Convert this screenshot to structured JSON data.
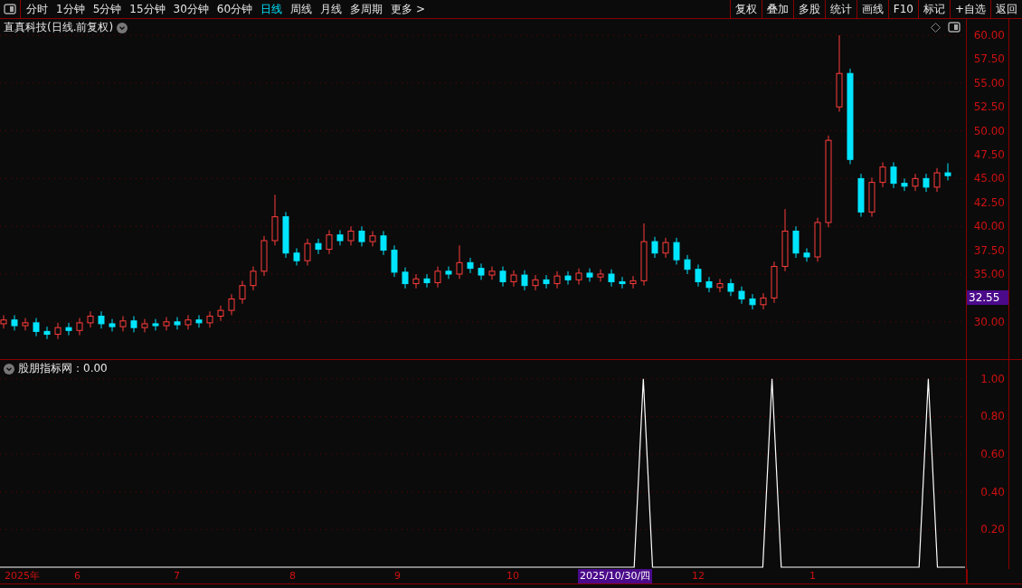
{
  "toolbar": {
    "periods": [
      {
        "label": "分时",
        "selected": false
      },
      {
        "label": "1分钟",
        "selected": false
      },
      {
        "label": "5分钟",
        "selected": false
      },
      {
        "label": "15分钟",
        "selected": false
      },
      {
        "label": "30分钟",
        "selected": false
      },
      {
        "label": "60分钟",
        "selected": false
      },
      {
        "label": "日线",
        "selected": true
      },
      {
        "label": "周线",
        "selected": false
      },
      {
        "label": "月线",
        "selected": false
      },
      {
        "label": "多周期",
        "selected": false
      },
      {
        "label": "更多 >",
        "selected": false
      }
    ],
    "buttons": [
      "复权",
      "叠加",
      "多股",
      "统计",
      "画线",
      "F10",
      "标记",
      "+自选",
      "返回"
    ]
  },
  "chart": {
    "title": "直真科技(日线.前复权)",
    "last_price": "32.55",
    "chart_data": {
      "type": "candlestick",
      "ylim": [
        26.1,
        61.7
      ],
      "grid": true,
      "yticks": [
        {
          "value": 60,
          "label": "60.00"
        },
        {
          "value": 57.5,
          "label": "57.50"
        },
        {
          "value": 55,
          "label": "55.00"
        },
        {
          "value": 52.5,
          "label": "52.50"
        },
        {
          "value": 50,
          "label": "50.00"
        },
        {
          "value": 47.5,
          "label": "47.50"
        },
        {
          "value": 45,
          "label": "45.00"
        },
        {
          "value": 42.5,
          "label": "42.50"
        },
        {
          "value": 40,
          "label": "40.00"
        },
        {
          "value": 37.5,
          "label": "37.50"
        },
        {
          "value": 35,
          "label": "35.00"
        },
        {
          "value": 30,
          "label": "30.00"
        }
      ],
      "ohlc": [
        [
          29.8,
          30.7,
          29.3,
          30.2
        ],
        [
          30.2,
          30.7,
          29.1,
          29.6
        ],
        [
          29.6,
          30.4,
          29.1,
          29.9
        ],
        [
          29.9,
          30.4,
          28.5,
          29.0
        ],
        [
          29.0,
          29.5,
          28.2,
          28.7
        ],
        [
          28.7,
          29.9,
          28.2,
          29.4
        ],
        [
          29.4,
          29.9,
          28.6,
          29.1
        ],
        [
          29.1,
          30.4,
          28.6,
          29.9
        ],
        [
          29.9,
          31.1,
          29.4,
          30.6
        ],
        [
          30.6,
          31.1,
          29.3,
          29.8
        ],
        [
          29.8,
          30.3,
          29.0,
          29.5
        ],
        [
          29.5,
          30.6,
          29.0,
          30.1
        ],
        [
          30.1,
          30.6,
          28.9,
          29.4
        ],
        [
          29.4,
          30.3,
          28.9,
          29.8
        ],
        [
          29.8,
          30.3,
          29.1,
          29.6
        ],
        [
          29.6,
          30.5,
          29.1,
          30.0
        ],
        [
          30.0,
          30.5,
          29.2,
          29.7
        ],
        [
          29.7,
          30.7,
          29.2,
          30.2
        ],
        [
          30.2,
          30.7,
          29.4,
          29.9
        ],
        [
          29.9,
          31.1,
          29.4,
          30.6
        ],
        [
          30.6,
          31.7,
          30.1,
          31.2
        ],
        [
          31.2,
          32.9,
          30.7,
          32.4
        ],
        [
          32.4,
          34.3,
          31.9,
          33.8
        ],
        [
          33.8,
          35.8,
          33.3,
          35.3
        ],
        [
          35.3,
          39.0,
          34.8,
          38.5
        ],
        [
          38.5,
          43.3,
          38.0,
          41.0
        ],
        [
          41.0,
          41.5,
          36.7,
          37.2
        ],
        [
          37.2,
          37.7,
          35.9,
          36.4
        ],
        [
          36.4,
          38.7,
          35.9,
          38.2
        ],
        [
          38.2,
          38.7,
          37.1,
          37.6
        ],
        [
          37.6,
          39.6,
          37.1,
          39.1
        ],
        [
          39.1,
          39.6,
          38.0,
          38.5
        ],
        [
          38.5,
          40.0,
          38.0,
          39.5
        ],
        [
          39.5,
          40.0,
          37.9,
          38.4
        ],
        [
          38.4,
          39.5,
          37.9,
          39.0
        ],
        [
          39.0,
          39.5,
          37.0,
          37.5
        ],
        [
          37.5,
          38.0,
          34.7,
          35.2
        ],
        [
          35.2,
          35.7,
          33.5,
          34.0
        ],
        [
          34.0,
          35.0,
          33.5,
          34.5
        ],
        [
          34.5,
          35.0,
          33.6,
          34.1
        ],
        [
          34.1,
          35.8,
          33.6,
          35.3
        ],
        [
          35.3,
          35.8,
          34.5,
          35.0
        ],
        [
          35.0,
          38.0,
          34.5,
          36.2
        ],
        [
          36.2,
          36.7,
          35.1,
          35.6
        ],
        [
          35.6,
          36.1,
          34.4,
          34.9
        ],
        [
          34.9,
          35.8,
          34.4,
          35.3
        ],
        [
          35.3,
          35.8,
          33.7,
          34.2
        ],
        [
          34.2,
          35.4,
          33.7,
          34.9
        ],
        [
          34.9,
          35.4,
          33.3,
          33.8
        ],
        [
          33.8,
          34.9,
          33.3,
          34.4
        ],
        [
          34.4,
          34.9,
          33.5,
          34.0
        ],
        [
          34.0,
          35.3,
          33.5,
          34.8
        ],
        [
          34.8,
          35.3,
          33.9,
          34.4
        ],
        [
          34.4,
          35.6,
          33.9,
          35.1
        ],
        [
          35.1,
          35.6,
          34.2,
          34.7
        ],
        [
          34.7,
          35.5,
          34.2,
          35.0
        ],
        [
          35.0,
          35.5,
          33.7,
          34.2
        ],
        [
          34.2,
          34.7,
          33.5,
          34.0
        ],
        [
          34.0,
          34.8,
          33.5,
          34.3
        ],
        [
          34.3,
          40.3,
          33.8,
          38.4
        ],
        [
          38.4,
          38.9,
          36.7,
          37.2
        ],
        [
          37.2,
          38.8,
          36.7,
          38.3
        ],
        [
          38.3,
          38.8,
          36.0,
          36.5
        ],
        [
          36.5,
          37.0,
          35.0,
          35.5
        ],
        [
          35.5,
          36.0,
          33.7,
          34.2
        ],
        [
          34.2,
          34.7,
          33.1,
          33.6
        ],
        [
          33.6,
          34.5,
          33.1,
          34.0
        ],
        [
          34.0,
          34.5,
          32.7,
          33.2
        ],
        [
          33.2,
          33.7,
          31.9,
          32.4
        ],
        [
          32.4,
          32.9,
          31.3,
          31.8
        ],
        [
          31.8,
          33.0,
          31.3,
          32.5
        ],
        [
          32.5,
          36.3,
          32.0,
          35.8
        ],
        [
          35.8,
          41.8,
          35.3,
          39.5
        ],
        [
          39.5,
          40.0,
          36.7,
          37.2
        ],
        [
          37.2,
          37.7,
          36.3,
          36.8
        ],
        [
          36.8,
          40.9,
          36.3,
          40.4
        ],
        [
          40.4,
          49.5,
          39.9,
          49.0
        ],
        [
          52.5,
          60.0,
          52.0,
          56.0
        ],
        [
          56.0,
          56.5,
          46.5,
          47.0
        ],
        [
          45.0,
          45.5,
          41.0,
          41.5
        ],
        [
          41.5,
          45.1,
          41.0,
          44.6
        ],
        [
          44.6,
          46.7,
          44.1,
          46.2
        ],
        [
          46.2,
          46.7,
          44.0,
          44.5
        ],
        [
          44.5,
          45.0,
          43.7,
          44.2
        ],
        [
          44.2,
          45.5,
          43.7,
          45.0
        ],
        [
          45.0,
          45.5,
          43.6,
          44.1
        ],
        [
          44.1,
          46.1,
          43.6,
          45.6
        ],
        [
          45.6,
          46.6,
          44.8,
          45.3
        ]
      ]
    }
  },
  "indicator": {
    "value": "：0.00",
    "chart_data": {
      "type": "line",
      "yticks": [
        {
          "value": 1.0,
          "label": "1.00"
        },
        {
          "value": 0.8,
          "label": "0.80"
        },
        {
          "value": 0.6,
          "label": "0.60"
        },
        {
          "value": 0.4,
          "label": "0.40"
        },
        {
          "value": 0.2,
          "label": "0.20"
        }
      ],
      "series": [
        {
          "name": "股朋指标网",
          "color": "#ffffff",
          "values": [
            0,
            0,
            0,
            0,
            0,
            0,
            0,
            0,
            0,
            0,
            0,
            0,
            0,
            0,
            0,
            0,
            0,
            0,
            0,
            0,
            0,
            0,
            0,
            0,
            0,
            0,
            0,
            0,
            0,
            0,
            0,
            0,
            0,
            0,
            0,
            0,
            0,
            0,
            0,
            0,
            0,
            0,
            0,
            0,
            0,
            0,
            0,
            0,
            0,
            0,
            0,
            0,
            0,
            0,
            0,
            0,
            0,
            0,
            0,
            0,
            0,
            0,
            0,
            0,
            0,
            0,
            0,
            0,
            0,
            0,
            1,
            0,
            0,
            0,
            0,
            0,
            0,
            0,
            0,
            0,
            0,
            0,
            0,
            0,
            1,
            0,
            0,
            0,
            0,
            0,
            0,
            0,
            0,
            0,
            0,
            0,
            0,
            0,
            0,
            0,
            0,
            1,
            0,
            0,
            0,
            0
          ]
        }
      ],
      "ylim": [
        0,
        1.1
      ],
      "grid": true
    }
  },
  "time_axis": [
    {
      "label": "2025年",
      "highlighted": false
    },
    {
      "label": "6",
      "highlighted": false
    },
    {
      "label": "7",
      "highlighted": false
    },
    {
      "label": "8",
      "highlighted": false
    },
    {
      "label": "9",
      "highlighted": false
    },
    {
      "label": "10",
      "highlighted": false
    },
    {
      "label": "2025/10/30/四",
      "highlighted": true
    },
    {
      "label": "12",
      "highlighted": false
    },
    {
      "label": "1",
      "highlighted": false
    }
  ]
}
